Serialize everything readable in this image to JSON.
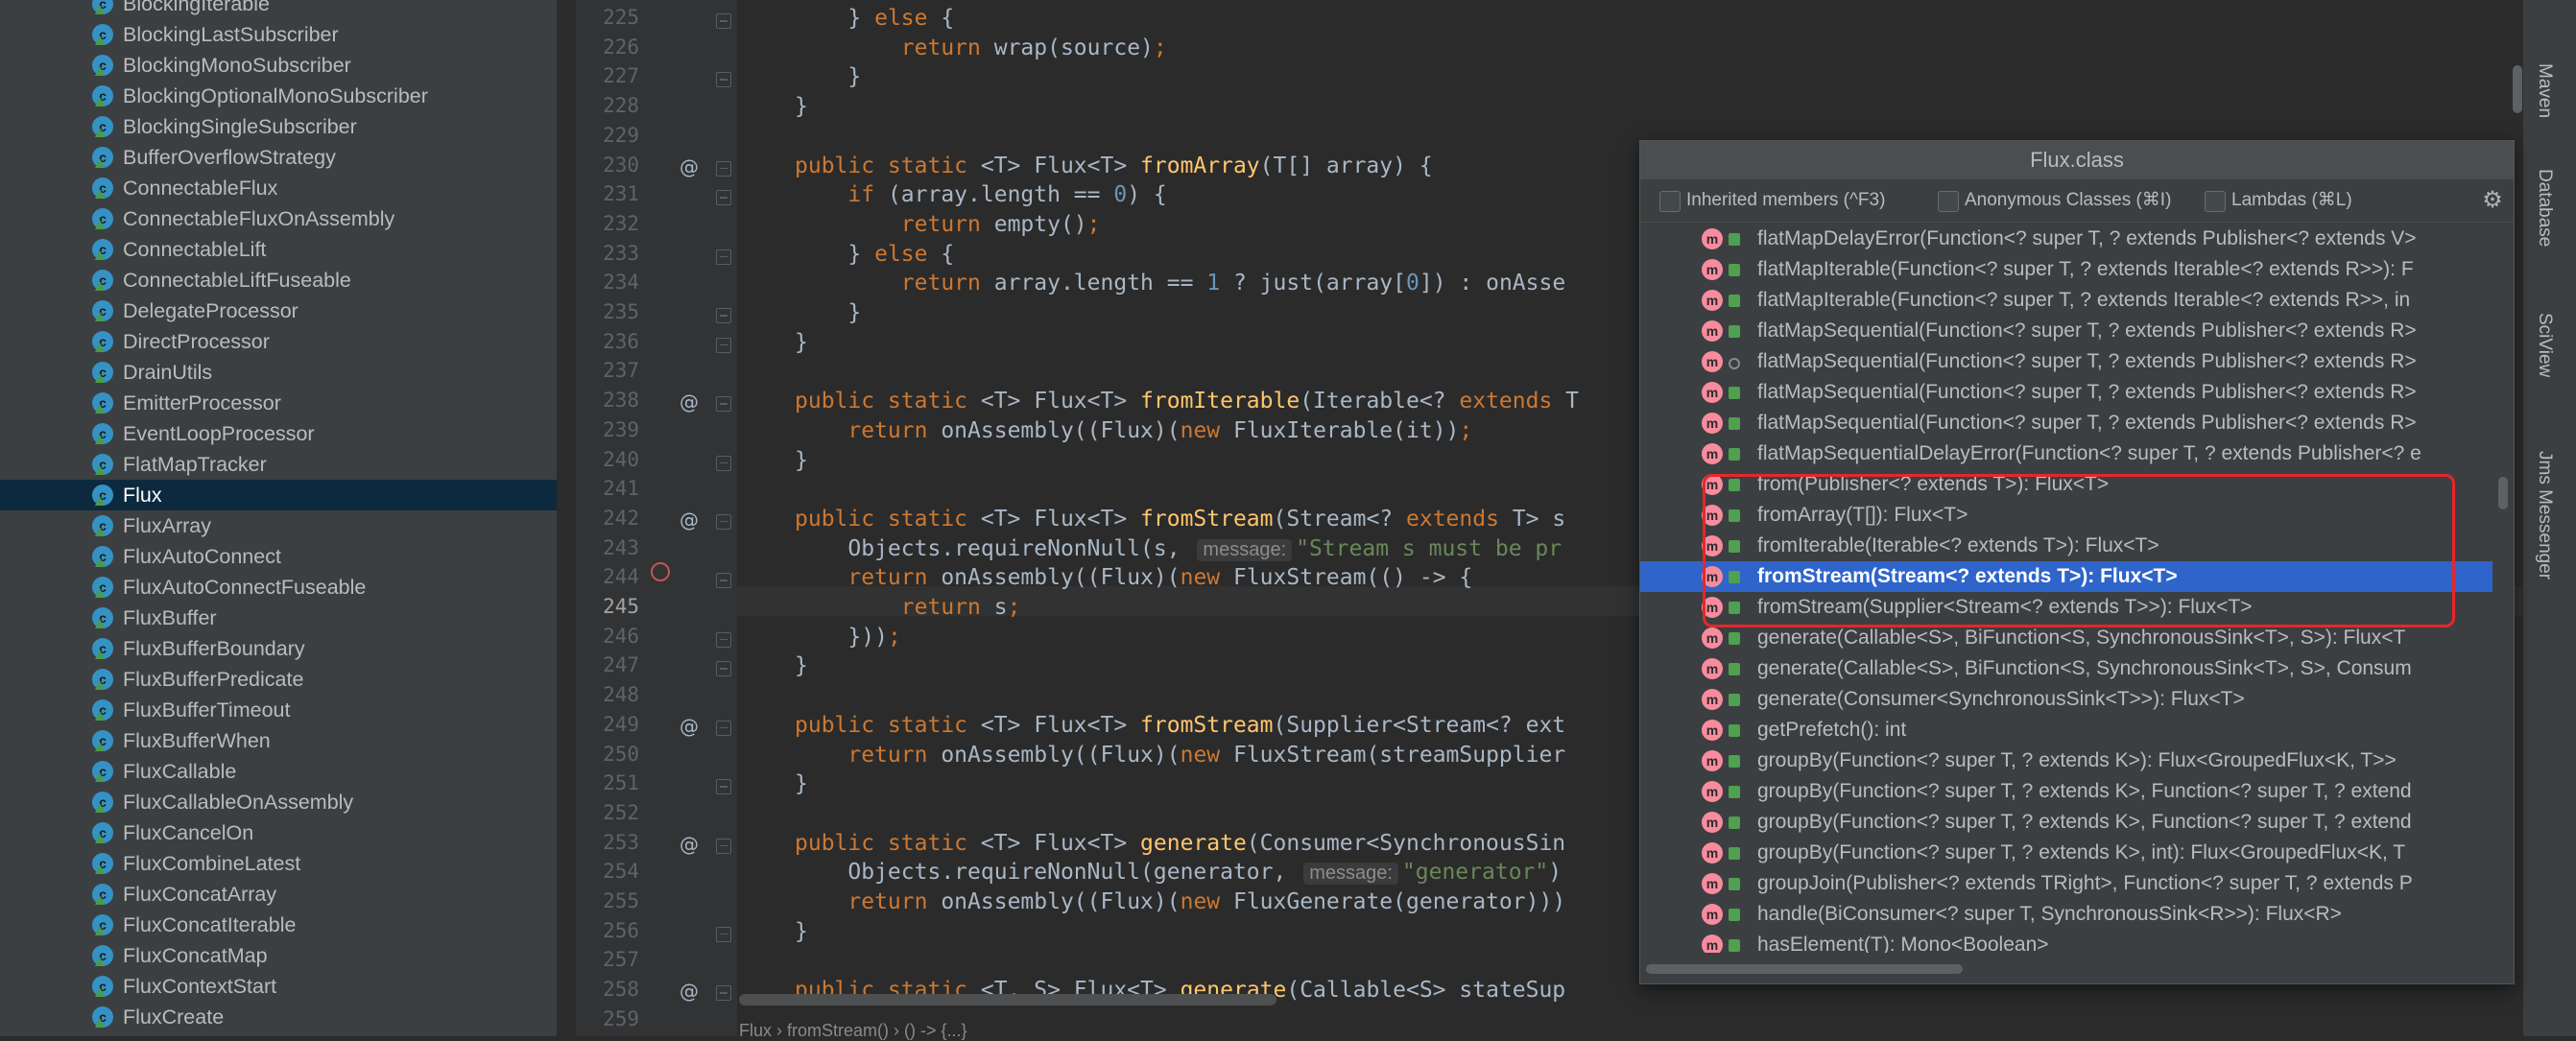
{
  "project_tree": {
    "items": [
      {
        "label": "BlockingIterable"
      },
      {
        "label": "BlockingLastSubscriber"
      },
      {
        "label": "BlockingMonoSubscriber"
      },
      {
        "label": "BlockingOptionalMonoSubscriber"
      },
      {
        "label": "BlockingSingleSubscriber"
      },
      {
        "label": "BufferOverflowStrategy"
      },
      {
        "label": "ConnectableFlux"
      },
      {
        "label": "ConnectableFluxOnAssembly"
      },
      {
        "label": "ConnectableLift"
      },
      {
        "label": "ConnectableLiftFuseable"
      },
      {
        "label": "DelegateProcessor"
      },
      {
        "label": "DirectProcessor"
      },
      {
        "label": "DrainUtils"
      },
      {
        "label": "EmitterProcessor"
      },
      {
        "label": "EventLoopProcessor"
      },
      {
        "label": "FlatMapTracker"
      },
      {
        "label": "Flux",
        "selected": true
      },
      {
        "label": "FluxArray"
      },
      {
        "label": "FluxAutoConnect"
      },
      {
        "label": "FluxAutoConnectFuseable"
      },
      {
        "label": "FluxBuffer"
      },
      {
        "label": "FluxBufferBoundary"
      },
      {
        "label": "FluxBufferPredicate"
      },
      {
        "label": "FluxBufferTimeout"
      },
      {
        "label": "FluxBufferWhen"
      },
      {
        "label": "FluxCallable"
      },
      {
        "label": "FluxCallableOnAssembly"
      },
      {
        "label": "FluxCancelOn"
      },
      {
        "label": "FluxCombineLatest"
      },
      {
        "label": "FluxConcatArray"
      },
      {
        "label": "FluxConcatIterable"
      },
      {
        "label": "FluxConcatMap"
      },
      {
        "label": "FluxContextStart"
      },
      {
        "label": "FluxCreate"
      }
    ]
  },
  "editor": {
    "line_numbers": [
      "225",
      "226",
      "227",
      "228",
      "229",
      "230",
      "231",
      "232",
      "233",
      "234",
      "235",
      "236",
      "237",
      "238",
      "239",
      "240",
      "241",
      "242",
      "243",
      "244",
      "245",
      "246",
      "247",
      "248",
      "249",
      "250",
      "251",
      "252",
      "253",
      "254",
      "255",
      "256",
      "257",
      "258",
      "259"
    ],
    "current_line": "245",
    "lines": [
      [
        {
          "t": "    } "
        },
        {
          "t": "else",
          "c": "kw"
        },
        {
          "t": " {"
        }
      ],
      [
        {
          "t": "        "
        },
        {
          "t": "return",
          "c": "kw"
        },
        {
          "t": " wrap(source)"
        },
        {
          "t": ";",
          "c": "kw"
        }
      ],
      [
        {
          "t": "    }"
        }
      ],
      [
        {
          "t": "}"
        }
      ],
      [
        {
          "t": ""
        }
      ],
      [
        {
          "t": "public static",
          "c": "kw"
        },
        {
          "t": " <T> Flux<T> "
        },
        {
          "t": "fromArray",
          "c": "fn"
        },
        {
          "t": "(T[] array) {"
        }
      ],
      [
        {
          "t": "    "
        },
        {
          "t": "if",
          "c": "kw"
        },
        {
          "t": " (array.length == "
        },
        {
          "t": "0",
          "c": "num"
        },
        {
          "t": ") {"
        }
      ],
      [
        {
          "t": "        "
        },
        {
          "t": "return",
          "c": "kw"
        },
        {
          "t": " empty()"
        },
        {
          "t": ";",
          "c": "kw"
        }
      ],
      [
        {
          "t": "    } "
        },
        {
          "t": "else",
          "c": "kw"
        },
        {
          "t": " {"
        }
      ],
      [
        {
          "t": "        "
        },
        {
          "t": "return",
          "c": "kw"
        },
        {
          "t": " array.length == "
        },
        {
          "t": "1",
          "c": "num"
        },
        {
          "t": " ? just(array["
        },
        {
          "t": "0",
          "c": "num"
        },
        {
          "t": "]) : onAsse"
        }
      ],
      [
        {
          "t": "    }"
        }
      ],
      [
        {
          "t": "}"
        }
      ],
      [
        {
          "t": ""
        }
      ],
      [
        {
          "t": "public static",
          "c": "kw"
        },
        {
          "t": " <T> Flux<T> "
        },
        {
          "t": "fromIterable",
          "c": "fn"
        },
        {
          "t": "(Iterable<? "
        },
        {
          "t": "extends",
          "c": "kw"
        },
        {
          "t": " T"
        }
      ],
      [
        {
          "t": "    "
        },
        {
          "t": "return",
          "c": "kw"
        },
        {
          "t": " onAssembly((Flux)("
        },
        {
          "t": "new",
          "c": "kw"
        },
        {
          "t": " FluxIterable(it))"
        },
        {
          "t": ";",
          "c": "kw"
        }
      ],
      [
        {
          "t": "}"
        }
      ],
      [
        {
          "t": ""
        }
      ],
      [
        {
          "t": "public static",
          "c": "kw"
        },
        {
          "t": " <T> Flux<T> "
        },
        {
          "t": "fromStream",
          "c": "fn"
        },
        {
          "t": "(Stream<? "
        },
        {
          "t": "extends",
          "c": "kw"
        },
        {
          "t": " T> s"
        }
      ],
      [
        {
          "t": "    Objects.requireNonNull(s, "
        },
        {
          "t": "message:",
          "c": "hint"
        },
        {
          "t": "\"Stream s must be pr",
          "c": "str"
        }
      ],
      [
        {
          "t": "    "
        },
        {
          "t": "return",
          "c": "kw"
        },
        {
          "t": " onAssembly((Flux)("
        },
        {
          "t": "new",
          "c": "kw"
        },
        {
          "t": " FluxStream(() -> {"
        }
      ],
      [
        {
          "t": "        "
        },
        {
          "t": "return",
          "c": "kw"
        },
        {
          "t": " s"
        },
        {
          "t": ";",
          "c": "kw"
        }
      ],
      [
        {
          "t": "    }))"
        },
        {
          "t": ";",
          "c": "kw"
        }
      ],
      [
        {
          "t": "}"
        }
      ],
      [
        {
          "t": ""
        }
      ],
      [
        {
          "t": "public static",
          "c": "kw"
        },
        {
          "t": " <T> Flux<T> "
        },
        {
          "t": "fromStream",
          "c": "fn"
        },
        {
          "t": "(Supplier<Stream<? ext"
        }
      ],
      [
        {
          "t": "    "
        },
        {
          "t": "return",
          "c": "kw"
        },
        {
          "t": " onAssembly((Flux)("
        },
        {
          "t": "new",
          "c": "kw"
        },
        {
          "t": " FluxStream(streamSupplier"
        }
      ],
      [
        {
          "t": "}"
        }
      ],
      [
        {
          "t": ""
        }
      ],
      [
        {
          "t": "public static",
          "c": "kw"
        },
        {
          "t": " <T> Flux<T> "
        },
        {
          "t": "generate",
          "c": "fn"
        },
        {
          "t": "(Consumer<SynchronousSin"
        }
      ],
      [
        {
          "t": "    Objects.requireNonNull(generator, "
        },
        {
          "t": "message:",
          "c": "hint"
        },
        {
          "t": "\"generator\"",
          "c": "str"
        },
        {
          "t": ")"
        }
      ],
      [
        {
          "t": "    "
        },
        {
          "t": "return",
          "c": "kw"
        },
        {
          "t": " onAssembly((Flux)("
        },
        {
          "t": "new",
          "c": "kw"
        },
        {
          "t": " FluxGenerate(generator)))"
        }
      ],
      [
        {
          "t": "}"
        }
      ],
      [
        {
          "t": ""
        }
      ],
      [
        {
          "t": "public static",
          "c": "kw"
        },
        {
          "t": " <T, S> Flux<T> "
        },
        {
          "t": "generate",
          "c": "fn"
        },
        {
          "t": "(Callable<S> stateSup"
        }
      ],
      [
        {
          "t": ""
        }
      ]
    ],
    "breadcrumb": "Flux  ›  fromStream()  ›  () -> {...}"
  },
  "right_strip": {
    "tabs": [
      "Maven",
      "Database",
      "SciView",
      "Jms Messenger"
    ]
  },
  "popup": {
    "title": "Flux.class",
    "filters": [
      {
        "label": "Inherited members (^F3)",
        "checked": false
      },
      {
        "label": "Anonymous Classes (⌘I)",
        "checked": false
      },
      {
        "label": "Lambdas (⌘L)",
        "checked": false
      }
    ],
    "members": [
      {
        "text": "flatMapDelayError(Function<? super T, ? extends Publisher<? extends V>"
      },
      {
        "text": "flatMapIterable(Function<? super T, ? extends Iterable<? extends R>>): F"
      },
      {
        "text": "flatMapIterable(Function<? super T, ? extends Iterable<? extends R>>, in"
      },
      {
        "text": "flatMapSequential(Function<? super T, ? extends Publisher<? extends R>"
      },
      {
        "text": "flatMapSequential(Function<? super T, ? extends Publisher<? extends R>",
        "lock": "open"
      },
      {
        "text": "flatMapSequential(Function<? super T, ? extends Publisher<? extends R>"
      },
      {
        "text": "flatMapSequential(Function<? super T, ? extends Publisher<? extends R>"
      },
      {
        "text": "flatMapSequentialDelayError(Function<? super T, ? extends Publisher<? e"
      },
      {
        "text": "from(Publisher<? extends T>): Flux<T>"
      },
      {
        "text": "fromArray(T[]): Flux<T>"
      },
      {
        "text": "fromIterable(Iterable<? extends T>): Flux<T>"
      },
      {
        "text": "fromStream(Stream<? extends T>): Flux<T>",
        "selected": true
      },
      {
        "text": "fromStream(Supplier<Stream<? extends T>>): Flux<T>"
      },
      {
        "text": "generate(Callable<S>, BiFunction<S, SynchronousSink<T>, S>): Flux<T"
      },
      {
        "text": "generate(Callable<S>, BiFunction<S, SynchronousSink<T>, S>, Consum"
      },
      {
        "text": "generate(Consumer<SynchronousSink<T>>): Flux<T>"
      },
      {
        "text": "getPrefetch(): int"
      },
      {
        "text": "groupBy(Function<? super T, ? extends K>): Flux<GroupedFlux<K, T>>"
      },
      {
        "text": "groupBy(Function<? super T, ? extends K>, Function<? super T, ? extend"
      },
      {
        "text": "groupBy(Function<? super T, ? extends K>, Function<? super T, ? extend"
      },
      {
        "text": "groupBy(Function<? super T, ? extends K>, int): Flux<GroupedFlux<K, T"
      },
      {
        "text": "groupJoin(Publisher<? extends TRight>, Function<? super T, ? extends P"
      },
      {
        "text": "handle(BiConsumer<? super T, SynchronousSink<R>>): Flux<R>"
      },
      {
        "text": "hasElement(T): Mono<Boolean>"
      }
    ]
  },
  "colors": {
    "background": "#2b2b2b",
    "selection": "#2f65ca",
    "tree_selection": "#0d293e",
    "highlight_box": "#e8262a",
    "keyword": "#cc7832",
    "method": "#ffc66d",
    "number": "#6897bb",
    "string": "#6a8759"
  }
}
